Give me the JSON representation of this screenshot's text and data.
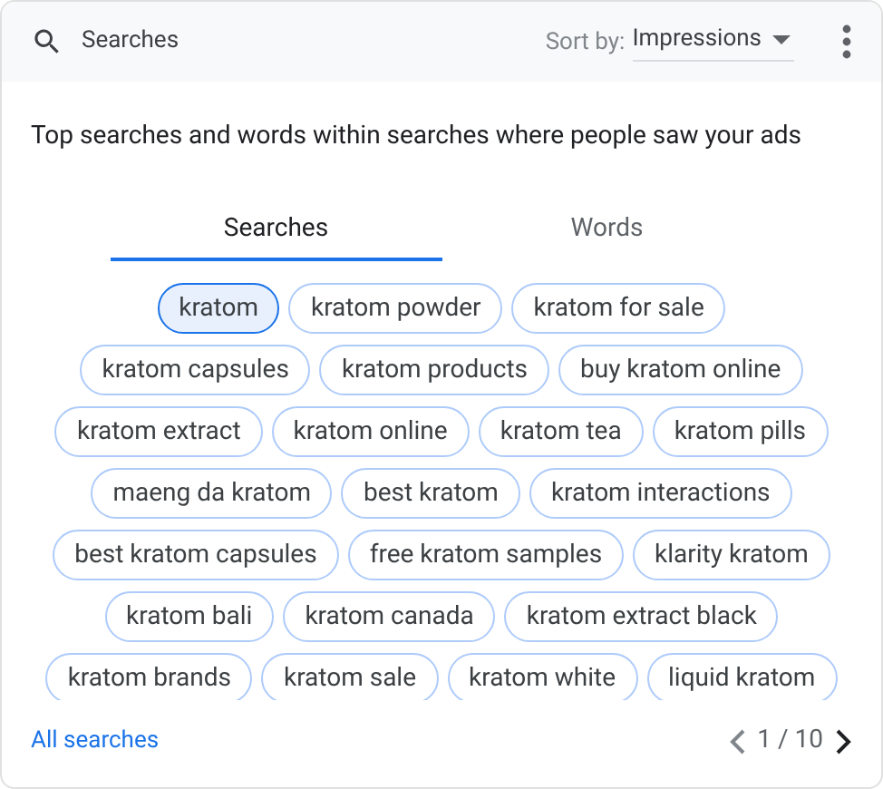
{
  "header": {
    "search_placeholder": "Searches",
    "sort_label": "Sort by:",
    "sort_value": "Impressions"
  },
  "description": "Top searches and words within searches where people saw your ads",
  "tabs": [
    {
      "label": "Searches",
      "selected": true
    },
    {
      "label": "Words",
      "selected": false
    }
  ],
  "chip_rows": [
    [
      {
        "label": "kratom",
        "selected": true
      },
      {
        "label": "kratom powder",
        "selected": false
      },
      {
        "label": "kratom for sale",
        "selected": false
      }
    ],
    [
      {
        "label": "kratom capsules",
        "selected": false
      },
      {
        "label": "kratom products",
        "selected": false
      },
      {
        "label": "buy kratom online",
        "selected": false
      }
    ],
    [
      {
        "label": "kratom extract",
        "selected": false
      },
      {
        "label": "kratom online",
        "selected": false
      },
      {
        "label": "kratom tea",
        "selected": false
      },
      {
        "label": "kratom pills",
        "selected": false
      }
    ],
    [
      {
        "label": "maeng da kratom",
        "selected": false
      },
      {
        "label": "best kratom",
        "selected": false
      },
      {
        "label": "kratom interactions",
        "selected": false
      }
    ],
    [
      {
        "label": "best kratom capsules",
        "selected": false
      },
      {
        "label": "free kratom samples",
        "selected": false
      },
      {
        "label": "klarity kratom",
        "selected": false
      }
    ],
    [
      {
        "label": "kratom bali",
        "selected": false
      },
      {
        "label": "kratom canada",
        "selected": false
      },
      {
        "label": "kratom extract black",
        "selected": false
      }
    ],
    [
      {
        "label": "kratom brands",
        "selected": false
      },
      {
        "label": "kratom sale",
        "selected": false
      },
      {
        "label": "kratom white",
        "selected": false
      },
      {
        "label": "liquid kratom",
        "selected": false
      }
    ]
  ],
  "footer": {
    "link": "All searches",
    "page": "1 / 10",
    "prev_disabled": true,
    "next_disabled": false
  }
}
